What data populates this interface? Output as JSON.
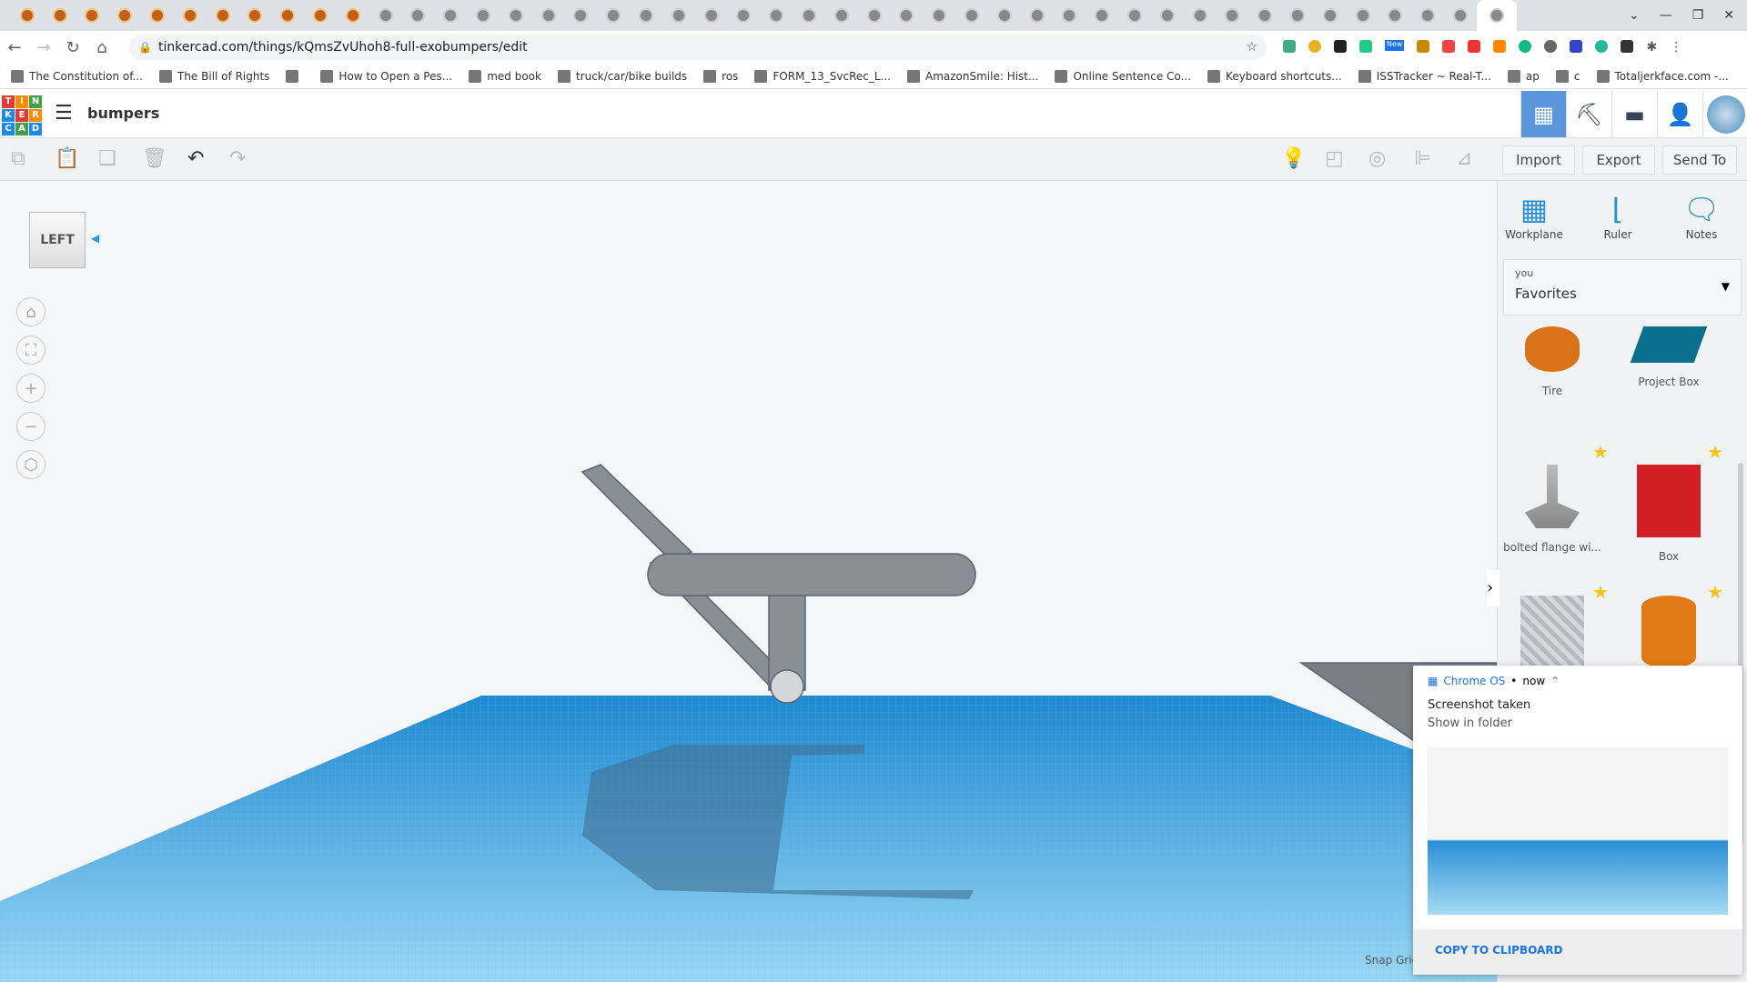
{
  "browser": {
    "url": "tinkercad.com/things/kQmsZvUhoh8-full-exobumpers/edit",
    "tab_count": 46,
    "bookmarks": [
      "The Constitution of...",
      "The Bill of Rights",
      "",
      "How to Open a Pes...",
      "med book",
      "truck/car/bike builds",
      "ros",
      "FORM_13_SvcRec_L...",
      "AmazonSmile: Hist...",
      "Online Sentence Co...",
      "Keyboard shortcuts...",
      "ISSTracker ~ Real-T...",
      "ap",
      "c",
      "Totaljerkface.com -..."
    ],
    "new_badge": "New"
  },
  "app": {
    "logo": [
      "T",
      "I",
      "N",
      "K",
      "E",
      "R",
      "C",
      "A",
      "D"
    ],
    "design_title": "bumpers",
    "header_icons": [
      "grid-view-icon",
      "pickaxe-icon",
      "brick-icon",
      "add-user-icon",
      "avatar"
    ],
    "toolbar": {
      "import": "Import",
      "export": "Export",
      "send_to": "Send To"
    },
    "view_cube": "LEFT",
    "tools": [
      {
        "label": "Workplane",
        "icon": "workplane-icon"
      },
      {
        "label": "Ruler",
        "icon": "ruler-icon"
      },
      {
        "label": "Notes",
        "icon": "notes-icon"
      }
    ],
    "library": {
      "owner": "you",
      "selected": "Favorites"
    },
    "shapes": [
      {
        "label": "Tire",
        "color": "#d9731a"
      },
      {
        "label": "Project Box",
        "color": "#0a6f8c"
      },
      {
        "label": "bolted flange wi...",
        "color": "#999"
      },
      {
        "label": "Box",
        "color": "#d41f26"
      },
      {
        "label": "",
        "color": "#b5b9c0"
      },
      {
        "label": "",
        "color": "#e07b18"
      }
    ],
    "snap_grid": "Snap Gric"
  },
  "notification": {
    "source": "Chrome OS",
    "time": "now",
    "title": "Screenshot taken",
    "subtitle": "Show in folder",
    "action": "COPY TO CLIPBOARD"
  }
}
